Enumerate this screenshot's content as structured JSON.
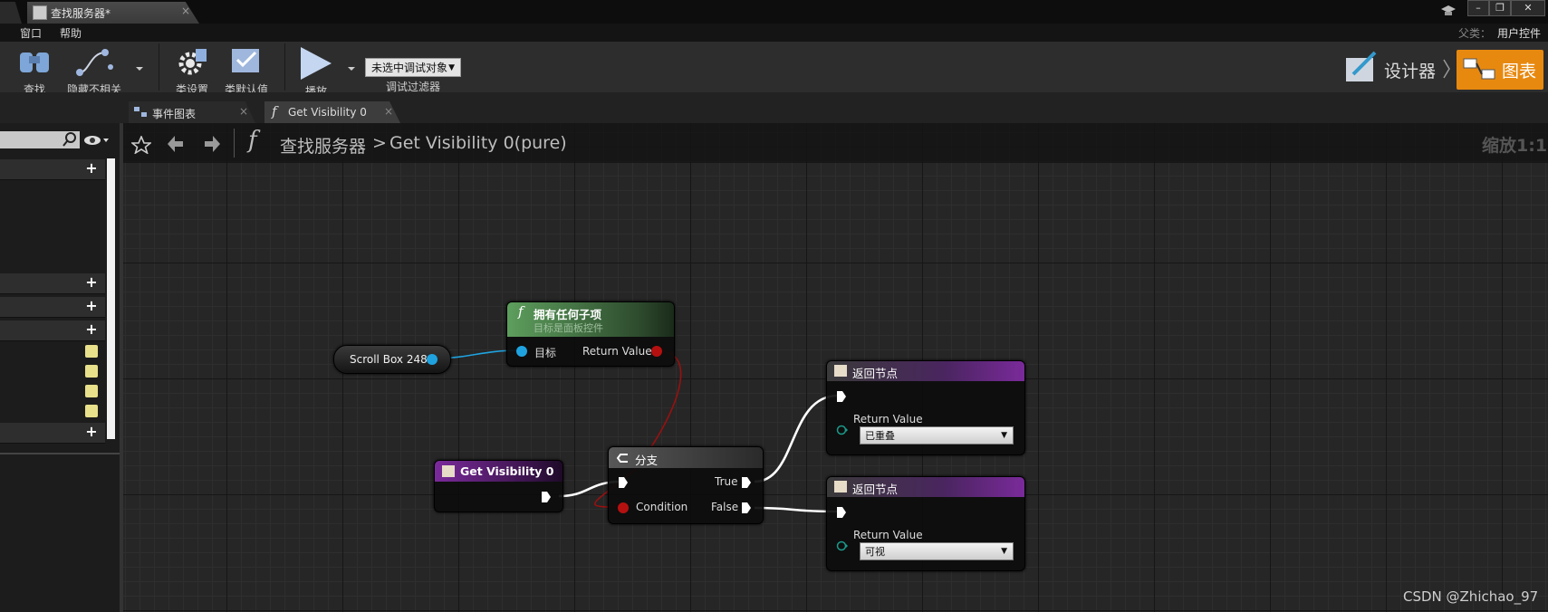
{
  "window": {
    "tab_title": "查找服务器*",
    "tab_close": "×",
    "win_controls": [
      "–",
      "❐",
      "✕"
    ]
  },
  "menubar": {
    "items": [
      "窗口",
      "帮助"
    ],
    "parent_label": "父类：",
    "parent_value": "用户控件"
  },
  "toolbar": {
    "find": "查找",
    "hide_unrelated": "隐藏不相关",
    "class_settings": "类设置",
    "class_defaults": "类默认值",
    "play": "播放",
    "debug_dropdown": "未选中调试对象",
    "debug_filter": "调试过滤器",
    "designer": "设计器",
    "graph": "图表"
  },
  "doc_tabs": [
    {
      "label": "事件图表",
      "close": "×"
    },
    {
      "label": "Get Visibility 0",
      "close": "×"
    }
  ],
  "breadcrumb": {
    "root": "查找服务器",
    "separator": ">",
    "current": "Get Visibility 0(pure)",
    "zoom": "缩放1:1"
  },
  "nodes": {
    "scroll_box": {
      "label": "Scroll Box 248"
    },
    "has_children": {
      "title": "拥有任何子项",
      "subtitle": "目标是面板控件",
      "pin_target": "目标",
      "pin_return": "Return Value"
    },
    "get_visibility": {
      "title": "Get Visibility 0"
    },
    "branch": {
      "title": "分支",
      "pin_condition": "Condition",
      "pin_true": "True",
      "pin_false": "False"
    },
    "return_1": {
      "title": "返回节点",
      "pin_label": "Return Value",
      "value": "已重叠"
    },
    "return_2": {
      "title": "返回节点",
      "pin_label": "Return Value",
      "value": "可视"
    }
  },
  "colors": {
    "accent_orange": "#e8890f",
    "function_green": "#4f8a4f",
    "purple": "#6b2a8a",
    "object_pin": "#1fa3e0",
    "bool_pin": "#b51010"
  },
  "watermark": "CSDN @Zhichao_97"
}
